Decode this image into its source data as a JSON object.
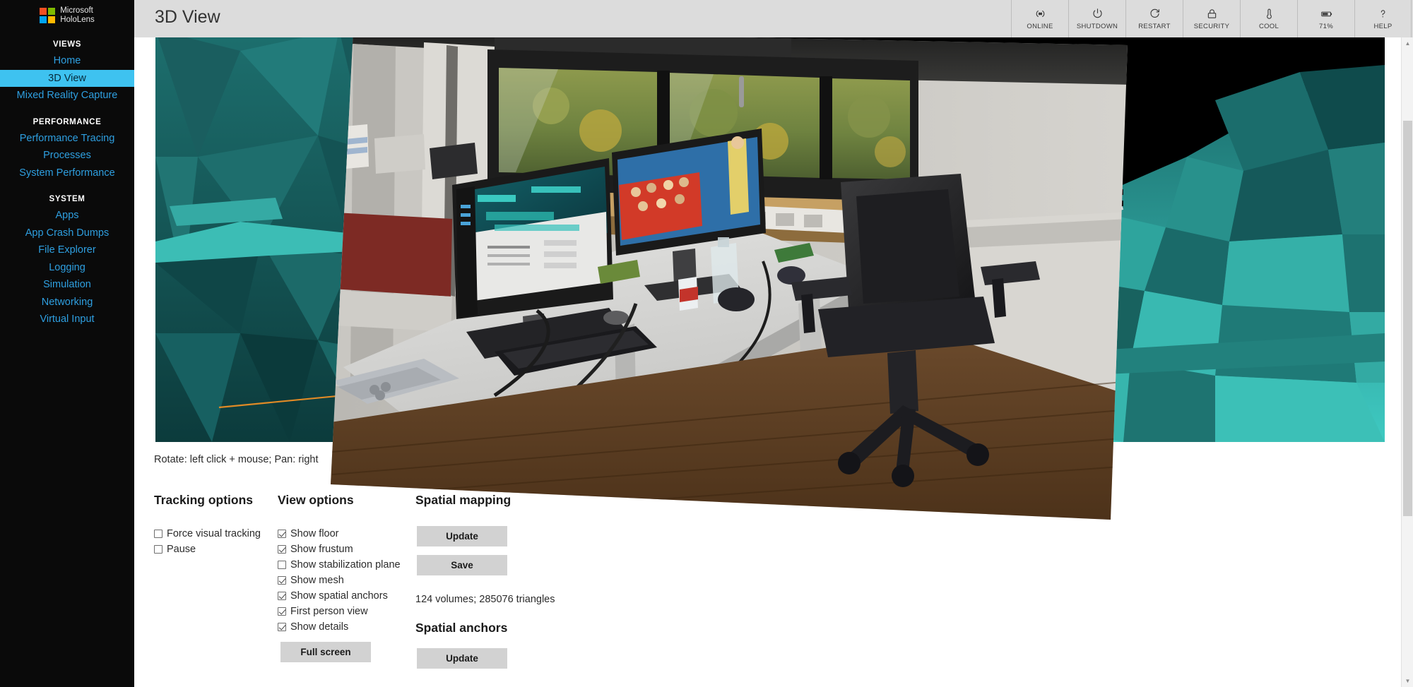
{
  "header": {
    "title": "3D View",
    "brand": {
      "line1": "Microsoft",
      "line2": "HoloLens"
    },
    "logo_colors": [
      "#f25022",
      "#7fba00",
      "#00a4ef",
      "#ffb900"
    ]
  },
  "toolbar": {
    "items": [
      {
        "label": "ONLINE",
        "icon": "wifi-icon"
      },
      {
        "label": "SHUTDOWN",
        "icon": "power-icon"
      },
      {
        "label": "RESTART",
        "icon": "restart-icon"
      },
      {
        "label": "SECURITY",
        "icon": "lock-icon"
      },
      {
        "label": "COOL",
        "icon": "thermometer-icon"
      },
      {
        "label": "71%",
        "icon": "battery-icon"
      },
      {
        "label": "HELP",
        "icon": "question-icon"
      }
    ]
  },
  "sidebar": {
    "groups": [
      {
        "title": "VIEWS",
        "items": [
          {
            "label": "Home",
            "active": false
          },
          {
            "label": "3D View",
            "active": true
          },
          {
            "label": "Mixed Reality Capture",
            "active": false
          }
        ]
      },
      {
        "title": "PERFORMANCE",
        "items": [
          {
            "label": "Performance Tracing",
            "active": false
          },
          {
            "label": "Processes",
            "active": false
          },
          {
            "label": "System Performance",
            "active": false
          }
        ]
      },
      {
        "title": "SYSTEM",
        "items": [
          {
            "label": "Apps",
            "active": false
          },
          {
            "label": "App Crash Dumps",
            "active": false
          },
          {
            "label": "File Explorer",
            "active": false
          },
          {
            "label": "Logging",
            "active": false
          },
          {
            "label": "Simulation",
            "active": false
          },
          {
            "label": "Networking",
            "active": false
          },
          {
            "label": "Virtual Input",
            "active": false
          }
        ]
      }
    ],
    "active_color": "#3ec2f0",
    "link_color": "#2e9fe0",
    "background": "#0a0a0a"
  },
  "viewport": {
    "hint": "Rotate: left click + mouse; Pan: right",
    "mesh_color": "#2bb3ae",
    "background": "#000000",
    "frustum_line_color": "#e08a26"
  },
  "panel": {
    "tracking": {
      "heading": "Tracking options",
      "options": [
        {
          "label": "Force visual tracking",
          "checked": false
        },
        {
          "label": "Pause",
          "checked": false
        }
      ]
    },
    "view": {
      "heading": "View options",
      "options": [
        {
          "label": "Show floor",
          "checked": true
        },
        {
          "label": "Show frustum",
          "checked": true
        },
        {
          "label": "Show stabilization plane",
          "checked": false
        },
        {
          "label": "Show mesh",
          "checked": true
        },
        {
          "label": "Show spatial anchors",
          "checked": true
        },
        {
          "label": "First person view",
          "checked": true
        },
        {
          "label": "Show details",
          "checked": true
        }
      ],
      "fullscreen_label": "Full screen"
    },
    "spatial_mapping": {
      "heading": "Spatial mapping",
      "update_label": "Update",
      "save_label": "Save",
      "stats": "124 volumes; 285076 triangles"
    },
    "spatial_anchors": {
      "heading": "Spatial anchors",
      "update_label": "Update"
    }
  },
  "scrollbar": {
    "up_glyph": "▲",
    "down_glyph": "▼"
  }
}
